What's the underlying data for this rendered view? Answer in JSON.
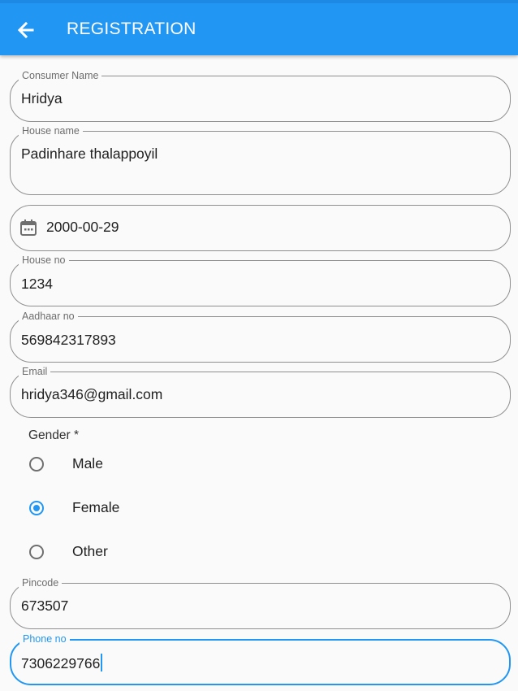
{
  "appbar": {
    "title": "REGISTRATION"
  },
  "fields": {
    "consumer_name": {
      "label": "Consumer Name",
      "value": "Hridya"
    },
    "house_name": {
      "label": "House name",
      "value": "Padinhare thalappoyil"
    },
    "date": {
      "value": "2000-00-29"
    },
    "house_no": {
      "label": "House no",
      "value": "1234"
    },
    "aadhaar_no": {
      "label": "Aadhaar no",
      "value": "569842317893"
    },
    "email": {
      "label": "Email",
      "value": "hridya346@gmail.com"
    },
    "pincode": {
      "label": "Pincode",
      "value": "673507"
    },
    "phone_no": {
      "label": "Phone no",
      "value": "7306229766"
    }
  },
  "gender": {
    "label": "Gender *",
    "options": [
      "Male",
      "Female",
      "Other"
    ],
    "selected": "Female"
  },
  "colors": {
    "primary": "#2196f3",
    "background": "#fafafa",
    "border": "#8f8f8f"
  },
  "icons": {
    "back": "arrow-back-icon",
    "date": "calendar-icon"
  }
}
